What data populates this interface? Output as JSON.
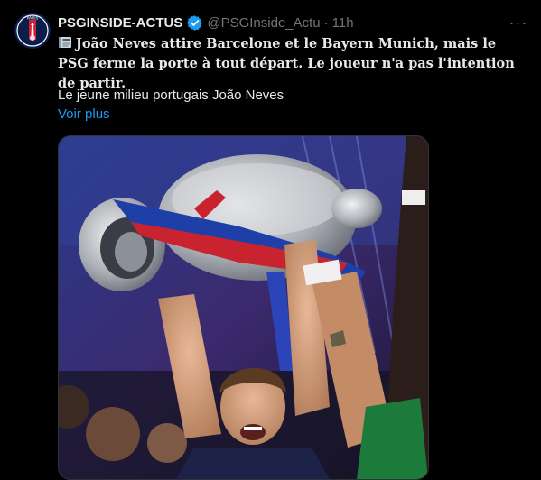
{
  "tweet": {
    "display_name": "PSGINSIDE-ACTUS",
    "handle": "@PSGInside_Actu",
    "separator": "·",
    "time": "11h",
    "more_label": "···",
    "body_main": "João Neves attire Barcelone et le Bayern Munich, mais le PSG ferme la porte à tout départ. Le joueur n'a pas l'intention de partir.",
    "body_sub": "Le jeune milieu portugais João Neves",
    "voir_plus": "Voir plus",
    "avatar_text": "PARIS"
  },
  "colors": {
    "background": "#000000",
    "text": "#e7e9ea",
    "muted": "#71767b",
    "link": "#1d9bf0",
    "verified": "#1d9bf0"
  },
  "icons": {
    "verified": "verified-badge-icon",
    "news": "newspaper-icon",
    "more": "more-dots-icon"
  }
}
